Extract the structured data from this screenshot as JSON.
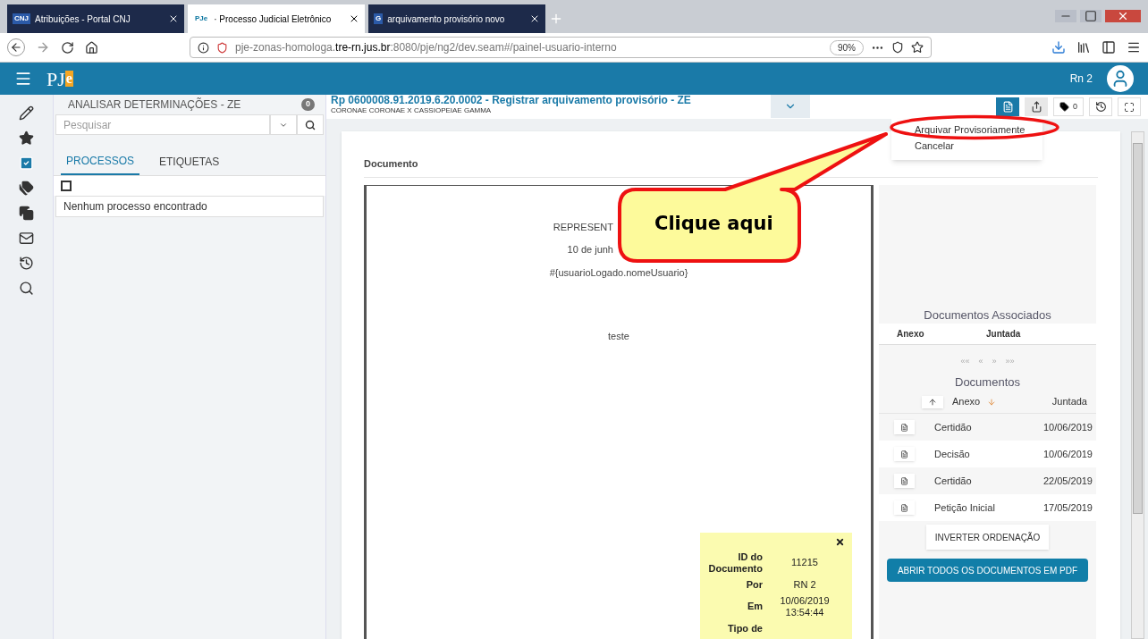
{
  "browser": {
    "tabs": [
      {
        "title": "Atribuições - Portal CNJ",
        "icon": "CNJ",
        "selected": false
      },
      {
        "title": "· Processo Judicial Eletrônico",
        "icon": "PJe",
        "selected": true
      },
      {
        "title": "arquivamento provisório novo",
        "icon": "G",
        "selected": false
      }
    ],
    "url_prefix": "pje-zonas-homologa.",
    "url_host": "tre-rn.jus.br",
    "url_rest": ":8080/pje/ng2/dev.seam#/painel-usuario-interno",
    "zoom": "90%"
  },
  "header": {
    "logo": "PJ",
    "logo_mark": "e",
    "user": "Rn 2"
  },
  "task_panel": {
    "title": "ANALISAR DETERMINAÇÕES - ZE",
    "count": "0",
    "search": {
      "placeholder": "Pesquisar"
    },
    "tabs": [
      {
        "label": "PROCESSOS",
        "selected": true
      },
      {
        "label": "ETIQUETAS",
        "selected": false
      }
    ],
    "select_all": {
      "checked": false
    },
    "empty_message": "Nenhum processo encontrado"
  },
  "process": {
    "title": "Rp 0600008.91.2019.6.20.0002 - Registrar arquivamento provisório - ZE",
    "parties": "CORONAE CORONAE X CASSIOPEIAE GAMMA",
    "tag_count": "0",
    "menu": [
      "Arquivar Provisoriamente",
      "Cancelar"
    ]
  },
  "document": {
    "heading": "Documento",
    "lines": [
      "REPRESENT",
      "10 de junh",
      "#{usuarioLogado.nomeUsuario}"
    ],
    "body": "teste",
    "info": [
      {
        "label": "ID do Documento",
        "value": "11215"
      },
      {
        "label": "Por",
        "value": "RN 2"
      },
      {
        "label": "Em",
        "value": "10/06/2019 13:54:44"
      },
      {
        "label": "Tipo de"
      }
    ]
  },
  "associated": {
    "title": "Documentos Associados",
    "columns": [
      "Anexo",
      "Juntada"
    ],
    "pager": [
      "««",
      "«",
      "»",
      "»»"
    ]
  },
  "documents": {
    "title": "Documentos",
    "columns": [
      "Anexo",
      "Juntada"
    ],
    "rows": [
      {
        "name": "Certidão",
        "date": "10/06/2019"
      },
      {
        "name": "Decisão",
        "date": "10/06/2019"
      },
      {
        "name": "Certidão",
        "date": "22/05/2019"
      },
      {
        "name": "Petição Inicial",
        "date": "17/05/2019"
      }
    ],
    "invert_button": "INVERTER ORDENAÇÃO",
    "pdf_button": "ABRIR TODOS OS DOCUMENTOS EM PDF"
  },
  "annotation": {
    "text": "Clique aqui"
  }
}
